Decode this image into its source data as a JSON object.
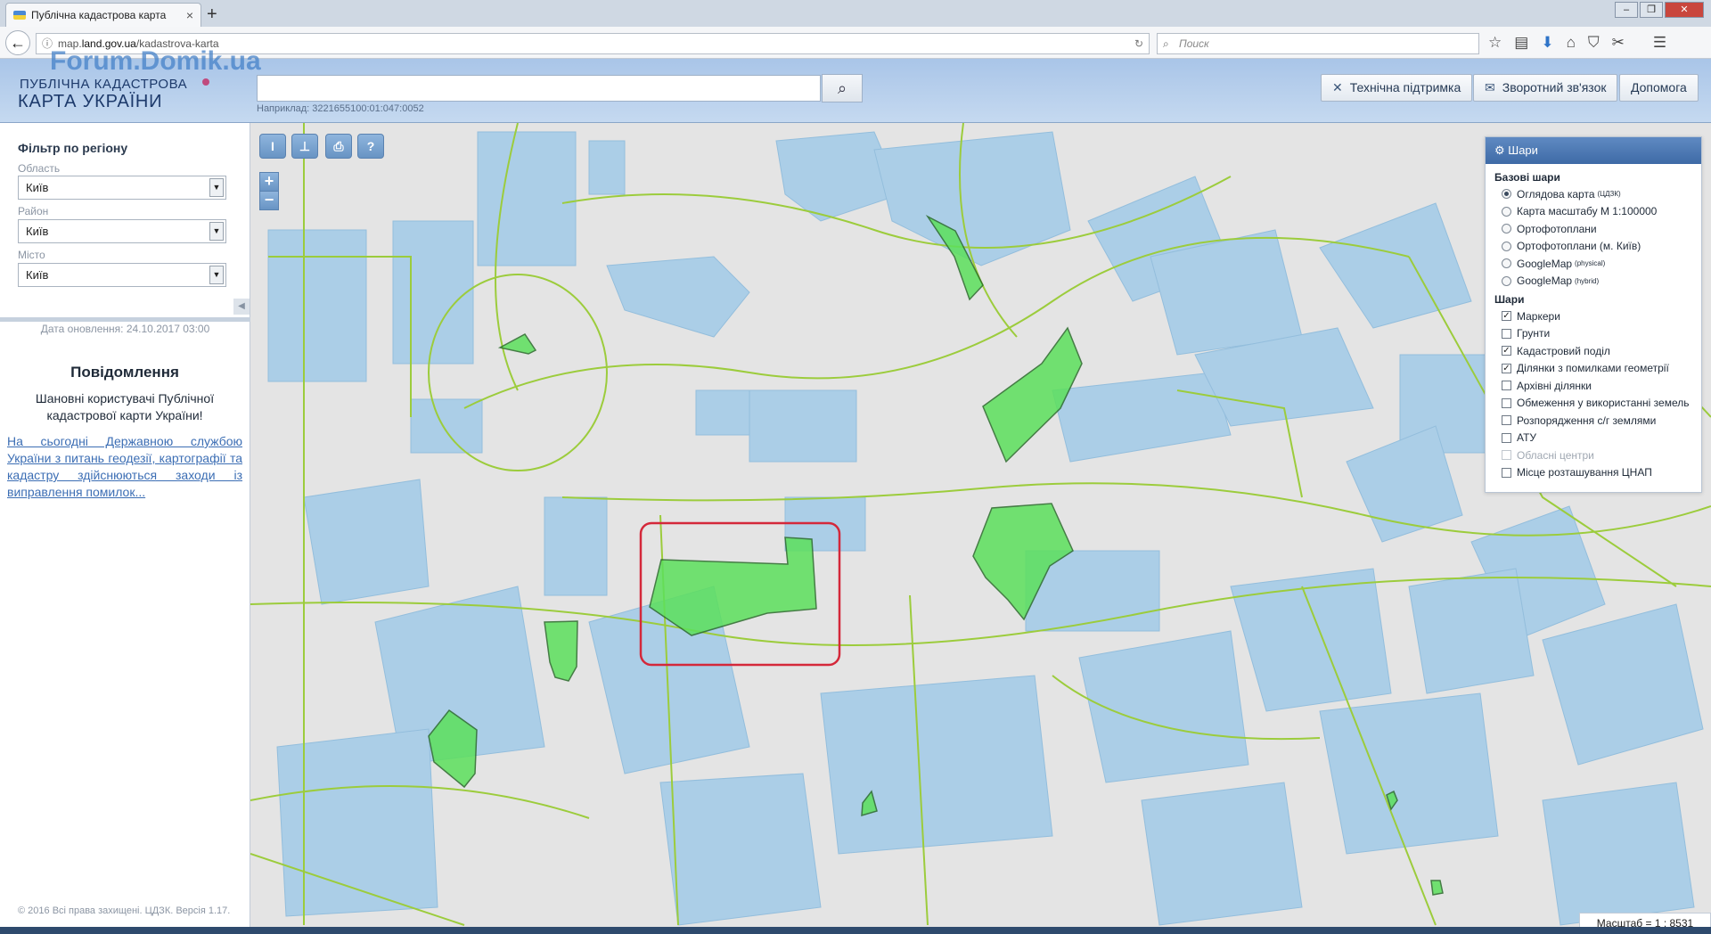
{
  "browser": {
    "tab_title": "Публічна кадастрова карта",
    "tab_close": "×",
    "new_tab": "+",
    "url_prefix": "map.",
    "url_domain": "land.gov.ua",
    "url_path": "/kadastrova-karta",
    "search_placeholder": "Поиск"
  },
  "header": {
    "watermark": "Forum.Domik.ua",
    "logo_line1": "ПУБЛІЧНА КАДАСТРОВА",
    "logo_line2": "КАРТА УКРАЇНИ",
    "search_value": "",
    "example": "Наприклад: 3221655100:01:047:0052",
    "buttons": {
      "support": "Технічна підтримка",
      "feedback": "Зворотний зв'язок",
      "help": "Допомога"
    }
  },
  "filter": {
    "title": "Фільтр по регіону",
    "region_label": "Область",
    "region_value": "Київ",
    "district_label": "Район",
    "district_value": "Київ",
    "city_label": "Місто",
    "city_value": "Київ"
  },
  "sidebar": {
    "updated": "Дата оновлення: 24.10.2017 03:00",
    "notice_title": "Повідомлення",
    "notice_text": "Шановні користувачі Публічної кадастрової карти України!",
    "notice_link": "На сьогодні Державною службою України з питань геодезії, картографії та кадастру здійснюються заходи із виправлення помилок...",
    "copyright": "© 2016 Всі права захищені. ЦДЗК. Версія 1.17."
  },
  "map_tools": {
    "ruler": "I",
    "area": "⊥",
    "print": "⎙",
    "identify": "?",
    "zoom_in": "+",
    "zoom_out": "−"
  },
  "layers": {
    "title": "Шари",
    "base_title": "Базові шари",
    "base": [
      {
        "label": "Оглядова карта",
        "sup": "(ЦДЗК)",
        "selected": true
      },
      {
        "label": "Карта масштабу М 1:100000",
        "sup": "",
        "selected": false
      },
      {
        "label": "Ортофотоплани",
        "sup": "",
        "selected": false
      },
      {
        "label": "Ортофотоплани (м. Київ)",
        "sup": "",
        "selected": false
      },
      {
        "label": "GoogleMap",
        "sup": "(physical)",
        "selected": false
      },
      {
        "label": "GoogleMap",
        "sup": "(hybrid)",
        "selected": false
      }
    ],
    "overlay_title": "Шари",
    "overlays": [
      {
        "label": "Маркери",
        "checked": true,
        "disabled": false
      },
      {
        "label": "Грунти",
        "checked": false,
        "disabled": false
      },
      {
        "label": "Кадастровий поділ",
        "checked": true,
        "disabled": false
      },
      {
        "label": "Ділянки з помилками геометрії",
        "checked": true,
        "disabled": false
      },
      {
        "label": "Архівні ділянки",
        "checked": false,
        "disabled": false
      },
      {
        "label": "Обмеження у використанні земель",
        "checked": false,
        "disabled": false
      },
      {
        "label": "Розпорядження с/г землями",
        "checked": false,
        "disabled": false
      },
      {
        "label": "АТУ",
        "checked": false,
        "disabled": false
      },
      {
        "label": "Обласні центри",
        "checked": false,
        "disabled": true
      },
      {
        "label": "Місце розташування ЦНАП",
        "checked": false,
        "disabled": false
      }
    ]
  },
  "scale": "Масштаб = 1 : 8531",
  "colors": {
    "parcel": "#a9cde8",
    "boundary": "#9ccc3c",
    "error_parcel": "#5ce05c",
    "highlight": "#d4283a"
  }
}
